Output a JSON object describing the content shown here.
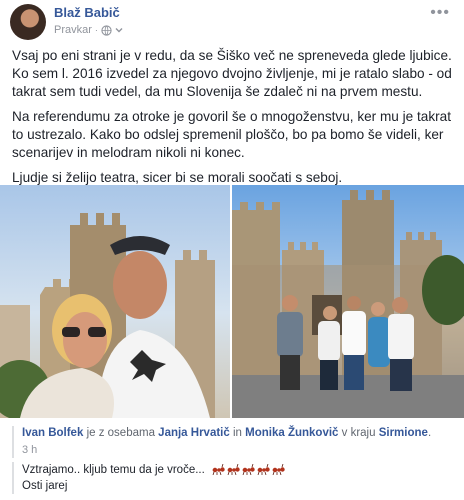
{
  "post": {
    "author": "Blaž Babič",
    "meta_label": "Pravkar",
    "privacy_icon": "globe-icon",
    "paragraphs": [
      "Vsaj po eni strani je v redu, da se Šiško več ne spreneveda glede ljubice. Ko sem l. 2016 izvedel za njegovo dvojno življenje, mi je ratalo slabo - od takrat sem tudi vedel, da mu Slovenija še zdaleč ni na prvem mestu.",
      "Na referendumu za otroke je govoril še o mnogoženstvu, ker mu je takrat to ustrezalo. Kako bo odslej spremenil ploščo, bo pa bomo še videli, ker scenarijev in melodram nikoli ni konec.",
      "Ljudje si želijo teatra, sicer bi se morali soočati s seboj."
    ]
  },
  "shared": {
    "person": "Ivan Bolfek",
    "with_text": "je z osebama",
    "tag1": "Janja Hrvatič",
    "and_text": "in",
    "tag2": "Monika Žunkovič",
    "place_text": "v kraju",
    "place": "Sirmione",
    "time": "3 h",
    "line1": "Vztrajamo.. kljub temu da je vroče...",
    "line2": "Osti jarej",
    "emoji_icon": "ant-emoji-icon"
  }
}
